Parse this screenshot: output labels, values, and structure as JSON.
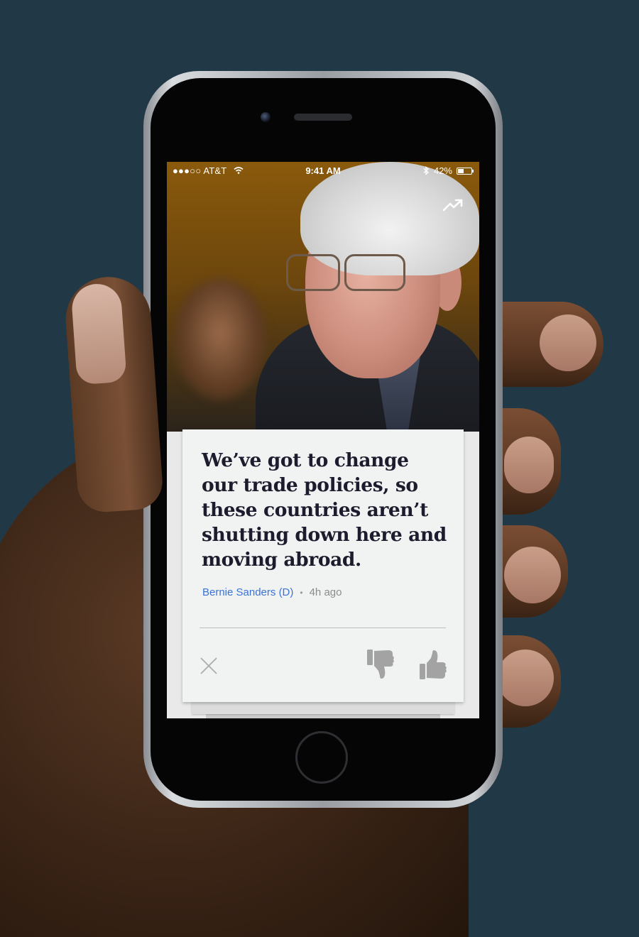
{
  "status_bar": {
    "carrier": "●●●○○ AT&T",
    "time": "9:41 AM",
    "battery": "42%",
    "battery_level": 0.42
  },
  "card": {
    "quote": "We’ve got to change our trade policies, so these countries aren’t shutting down here and moving abroad.",
    "author": "Bernie Sanders (D)",
    "separator": "•",
    "time_ago": "4h ago"
  },
  "icons": {
    "trending": "trending-up-icon",
    "dismiss": "close-icon",
    "dislike": "thumbs-down-icon",
    "like": "thumbs-up-icon"
  },
  "colors": {
    "background": "#213847",
    "author_link": "#3a73d6",
    "quote_text": "#1d1c2e",
    "card": "#f1f2f2",
    "action_icons": "#a3a3a3"
  }
}
